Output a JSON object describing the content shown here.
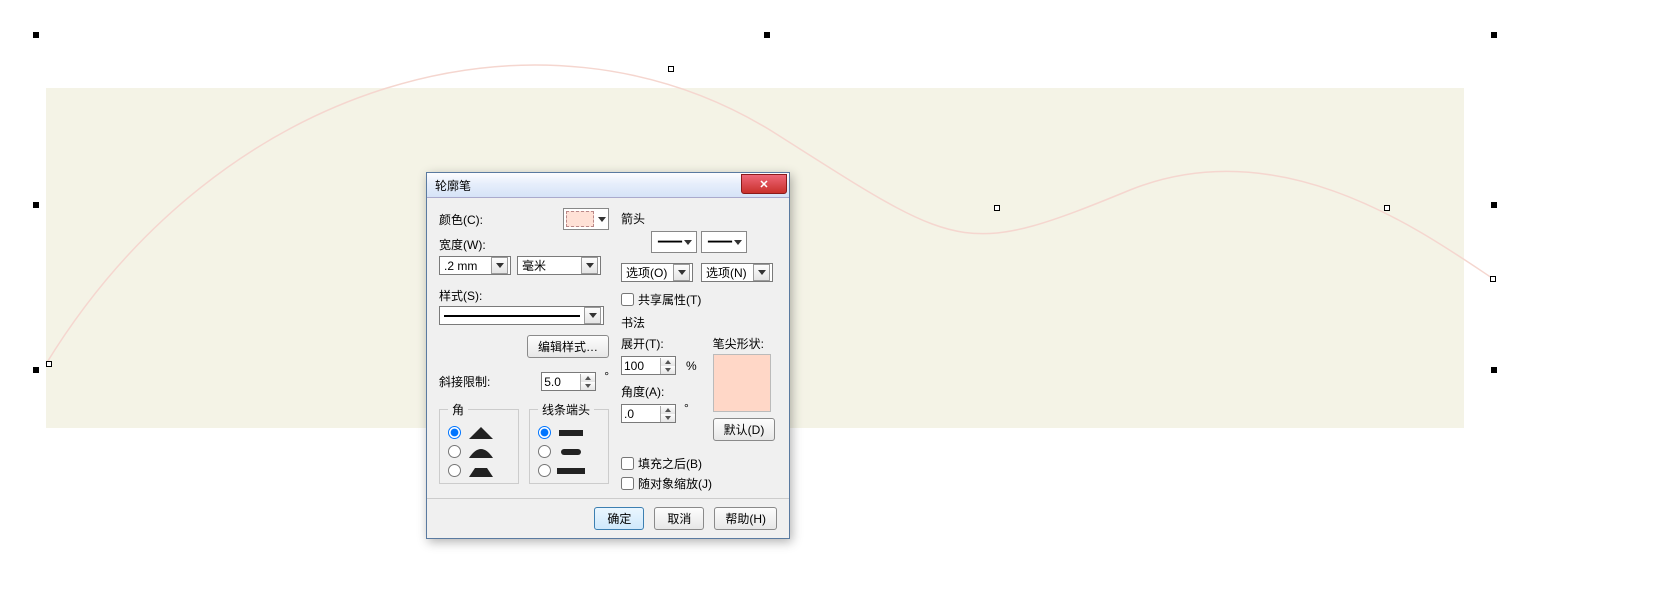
{
  "dialog": {
    "title": "轮廓笔",
    "color_label": "颜色(C):",
    "width_label": "宽度(W):",
    "width_value": ".2 mm",
    "unit_value": "毫米",
    "style_label": "样式(S):",
    "edit_style_btn": "编辑样式…",
    "miter_label": "斜接限制:",
    "miter_value": "5.0",
    "corner_label": "角",
    "caps_label": "线条端头",
    "arrow_label": "箭头",
    "options_left": "选项(O)",
    "options_right": "选项(N)",
    "share_attr": "共享属性(T)",
    "calligraphy_label": "书法",
    "spread_label": "展开(T):",
    "spread_value": "100",
    "spread_suffix": "%",
    "angle_label": "角度(A):",
    "angle_value": ".0",
    "nib_label": "笔尖形状:",
    "default_btn": "默认(D)",
    "behind_fill": "填充之后(B)",
    "scale_with": "随对象缩放(J)",
    "ok": "确定",
    "cancel": "取消",
    "help": "帮助(H)"
  }
}
